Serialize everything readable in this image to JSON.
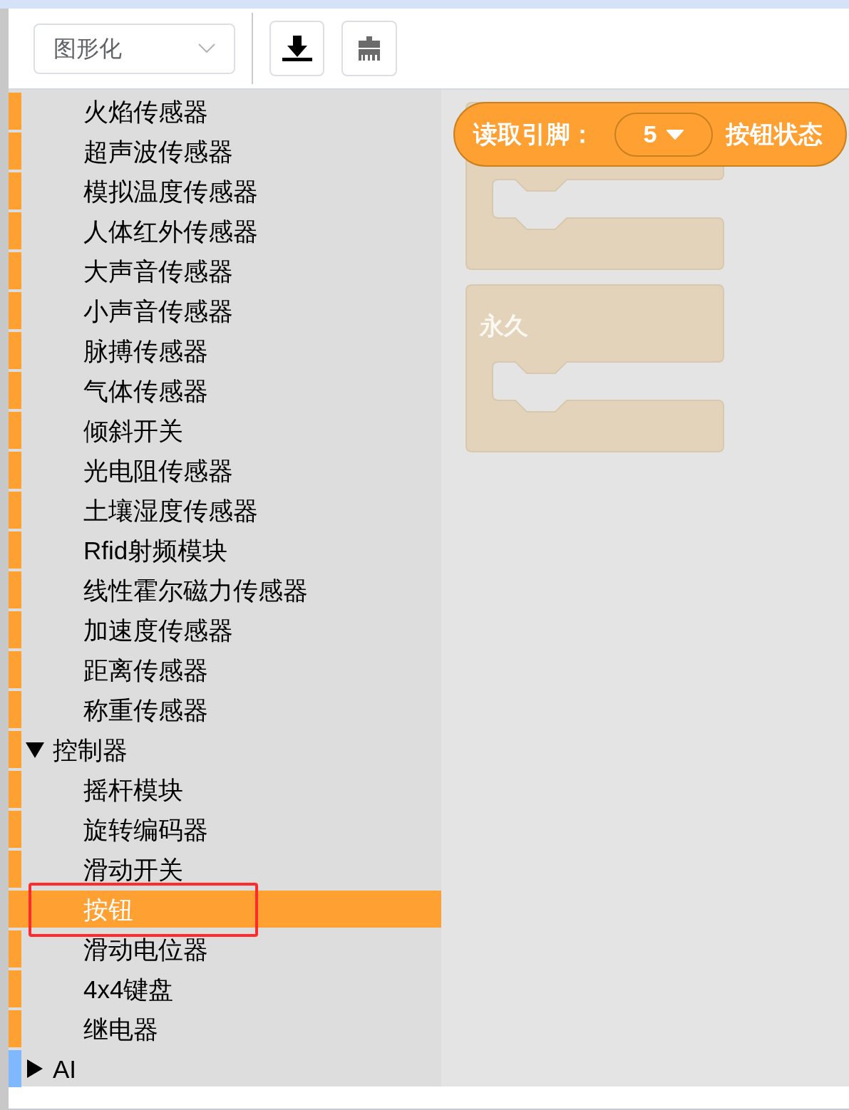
{
  "toolbar": {
    "mode_select": {
      "value": "图形化"
    }
  },
  "sidebar": {
    "items": [
      {
        "expanded": true,
        "children": [
          {
            "label": "火焰传感器",
            "selected": false,
            "color": "#ffa033"
          },
          {
            "label": "超声波传感器",
            "selected": false,
            "color": "#ffa033"
          },
          {
            "label": "模拟温度传感器",
            "selected": false,
            "color": "#ffa033"
          },
          {
            "label": "人体红外传感器",
            "selected": false,
            "color": "#ffa033"
          },
          {
            "label": "大声音传感器",
            "selected": false,
            "color": "#ffa033"
          },
          {
            "label": "小声音传感器",
            "selected": false,
            "color": "#ffa033"
          },
          {
            "label": "脉搏传感器",
            "selected": false,
            "color": "#ffa033"
          },
          {
            "label": "气体传感器",
            "selected": false,
            "color": "#ffa033"
          },
          {
            "label": "倾斜开关",
            "selected": false,
            "color": "#ffa033"
          },
          {
            "label": "光电阻传感器",
            "selected": false,
            "color": "#ffa033"
          },
          {
            "label": "土壤湿度传感器",
            "selected": false,
            "color": "#ffa033"
          },
          {
            "label": "Rfid射频模块",
            "selected": false,
            "color": "#ffa033"
          },
          {
            "label": "线性霍尔磁力传感器",
            "selected": false,
            "color": "#ffa033"
          },
          {
            "label": "加速度传感器",
            "selected": false,
            "color": "#ffa033"
          },
          {
            "label": "距离传感器",
            "selected": false,
            "color": "#ffa033"
          },
          {
            "label": "称重传感器",
            "selected": false,
            "color": "#ffa033"
          }
        ]
      },
      {
        "label": "控制器",
        "expanded": true,
        "color": "#ffa033",
        "children": [
          {
            "label": "摇杆模块",
            "selected": false,
            "color": "#ffa033"
          },
          {
            "label": "旋转编码器",
            "selected": false,
            "color": "#ffa033"
          },
          {
            "label": "滑动开关",
            "selected": false,
            "color": "#ffa033"
          },
          {
            "label": "按钮",
            "selected": true,
            "annotated": true,
            "color": "#ffa033"
          },
          {
            "label": "滑动电位器",
            "selected": false,
            "color": "#ffa033"
          },
          {
            "label": "4x4键盘",
            "selected": false,
            "color": "#ffa033"
          },
          {
            "label": "继电器",
            "selected": false,
            "color": "#ffa033"
          }
        ]
      },
      {
        "label": "AI",
        "expanded": false,
        "color": "#80b8ff"
      }
    ]
  },
  "workspace": {
    "active_block": {
      "label": "读取引脚：",
      "pin": "5",
      "suffix": "按钮状态"
    },
    "ghost_blocks": [
      {
        "kind": "loop"
      },
      {
        "kind": "loop",
        "label": "永久"
      }
    ]
  }
}
